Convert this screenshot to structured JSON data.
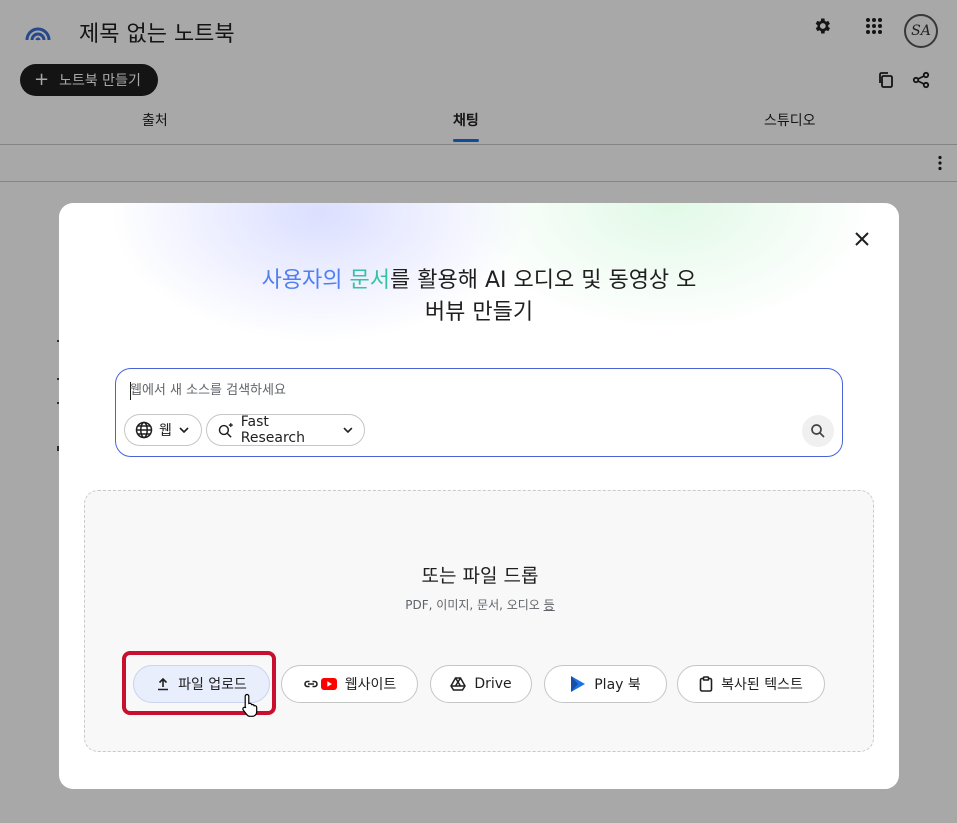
{
  "app": {
    "title": "제목 없는 노트북",
    "create_label": "노트북 만들기"
  },
  "tabs": [
    {
      "label": "출처"
    },
    {
      "label": "채팅"
    },
    {
      "label": "스튜디오"
    }
  ],
  "modal": {
    "headline_part1": "사용자의 ",
    "headline_part2": "문서",
    "headline_part3": "를 활용해 AI 오디오 및 동영상 오",
    "headline_line2": "버뷰 만들기",
    "search": {
      "placeholder": "웹에서 새 소스를 검색하세요",
      "source_chip": "웹",
      "mode_chip": "Fast Research"
    },
    "drop": {
      "title": "또는 파일 드롭",
      "subtitle_main": "PDF, 이미지, 문서, 오디오 ",
      "subtitle_more": "등"
    },
    "buttons": {
      "upload": "파일 업로드",
      "website": "웹사이트",
      "drive": "Drive",
      "playbooks": "Play 북",
      "pasted": "복사된 텍스트"
    }
  },
  "icons": [
    "notebook-logo-icon",
    "settings-icon",
    "apps-grid-icon",
    "avatar",
    "copy-icon",
    "share-icon",
    "more-vert-icon",
    "close-icon",
    "globe-icon",
    "chevron-down-icon",
    "research-sparkle-icon",
    "search-icon",
    "upload-icon",
    "link-icon",
    "youtube-icon",
    "drive-icon",
    "play-books-icon",
    "clipboard-icon",
    "pointer-cursor-icon"
  ],
  "colors": {
    "accent": "#1a73e8",
    "highlight": "#c8102e",
    "gradient_blue": "#4f7ff2",
    "gradient_teal": "#34c2a5",
    "youtube": "#ff0000"
  }
}
